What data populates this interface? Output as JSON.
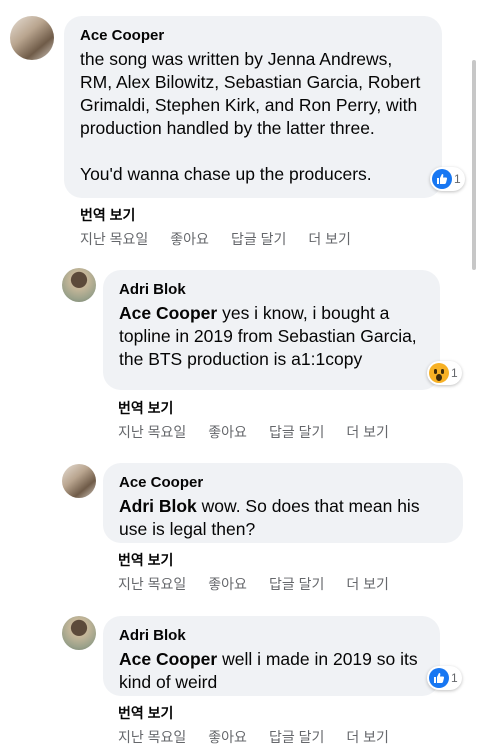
{
  "comments": [
    {
      "author": "Ace Cooper",
      "tag": "",
      "text": "the song was written by Jenna Andrews, RM, Alex Bilowitz, Sebastian Garcia, Robert Grimaldi, Stephen Kirk, and Ron Perry, with production handled by the latter three.\n\nYou'd wanna chase up the producers.",
      "reaction": {
        "icon": "like-icon",
        "count": "1"
      },
      "translate": "번역 보기",
      "time": "지난 목요일",
      "like": "좋아요",
      "reply": "답글 달기",
      "more": "더 보기"
    },
    {
      "author": "Adri Blok",
      "tag": "Ace Cooper",
      "text": " yes i know, i bought a topline in 2019 from Sebastian Garcia, the BTS production is a1:1copy",
      "reaction": {
        "icon": "wow-icon",
        "count": "1"
      },
      "translate": "번역 보기",
      "time": "지난 목요일",
      "like": "좋아요",
      "reply": "답글 달기",
      "more": "더 보기"
    },
    {
      "author": "Ace Cooper",
      "tag": "Adri Blok",
      "text": " wow. So does that mean his use is legal then?",
      "translate": "번역 보기",
      "time": "지난 목요일",
      "like": "좋아요",
      "reply": "답글 달기",
      "more": "더 보기"
    },
    {
      "author": "Adri Blok",
      "tag": "Ace Cooper",
      "text": " well i made in 2019 so its kind of weird",
      "reaction": {
        "icon": "like-icon",
        "count": "1"
      },
      "translate": "번역 보기",
      "time": "지난 목요일",
      "like": "좋아요",
      "reply": "답글 달기",
      "more": "더 보기"
    }
  ],
  "colors": {
    "bubble": "#f0f2f5",
    "meta": "#65676b",
    "like": "#1877f2",
    "wow": "#f7b125"
  }
}
